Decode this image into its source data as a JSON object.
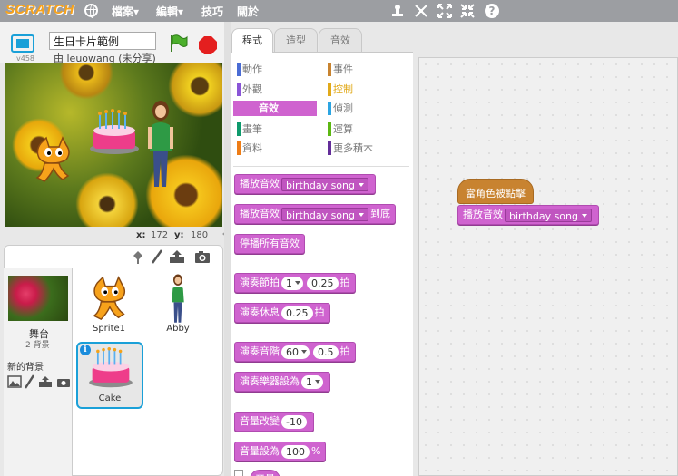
{
  "topbar": {
    "logo": "SCRATCH",
    "menus": [
      {
        "label": "檔案▾"
      },
      {
        "label": "編輯▾"
      },
      {
        "label": "技巧"
      },
      {
        "label": "關於"
      }
    ],
    "tool_icons": [
      "duplicate-icon",
      "cut-icon",
      "grow-icon",
      "shrink-icon",
      "help-icon"
    ]
  },
  "stage_header": {
    "version": "v458",
    "project_title": "生日卡片範例",
    "owner": "由 leuowang (未分享)"
  },
  "coords": {
    "x_label": "x:",
    "x": "172",
    "y_label": "y:",
    "y": "180"
  },
  "sprites": {
    "stage_label": "舞台",
    "stage_backdrops": "2 背景",
    "new_backdrop": "新的背景",
    "items": [
      {
        "name": "Sprite1"
      },
      {
        "name": "Abby"
      },
      {
        "name": "Cake"
      }
    ]
  },
  "tabs": [
    {
      "label": "程式"
    },
    {
      "label": "造型"
    },
    {
      "label": "音效"
    }
  ],
  "categories": [
    {
      "label": "動作",
      "color": "#4a6cd4"
    },
    {
      "label": "事件",
      "color": "#c88330"
    },
    {
      "label": "外觀",
      "color": "#8a55d7"
    },
    {
      "label": "控制",
      "color": "#e1a91a"
    },
    {
      "label": "音效",
      "color": "#cf63cf"
    },
    {
      "label": "偵測",
      "color": "#2ca5e2"
    },
    {
      "label": "畫筆",
      "color": "#0e9a6c"
    },
    {
      "label": "運算",
      "color": "#5cb712"
    },
    {
      "label": "資料",
      "color": "#ee7d16"
    },
    {
      "label": "更多積木",
      "color": "#632d99"
    }
  ],
  "blocks": {
    "play_sound": "播放音效",
    "sound_name": "birthday song",
    "play_until_done": "播放音效",
    "until_done_suffix": "到底",
    "stop_all": "停播所有音效",
    "play_drum": "演奏節拍",
    "drum_num": "1",
    "drum_beats": "0.25",
    "beats": "拍",
    "rest": "演奏休息",
    "rest_beats": "0.25",
    "rest_beats_unit": "拍",
    "play_note": "演奏音階",
    "note_num": "60",
    "note_beats": "0.5",
    "note_beats_unit": "拍",
    "set_instrument": "演奏樂器設為",
    "instrument_num": "1",
    "change_volume": "音量改變",
    "volume_change_val": "-10",
    "set_volume": "音量設為",
    "volume_val": "100",
    "volume_pct": "%",
    "volume_reporter": "音量"
  },
  "script": {
    "hat": "當角色被點擊",
    "play_sound": "播放音效",
    "sound_name": "birthday song"
  }
}
